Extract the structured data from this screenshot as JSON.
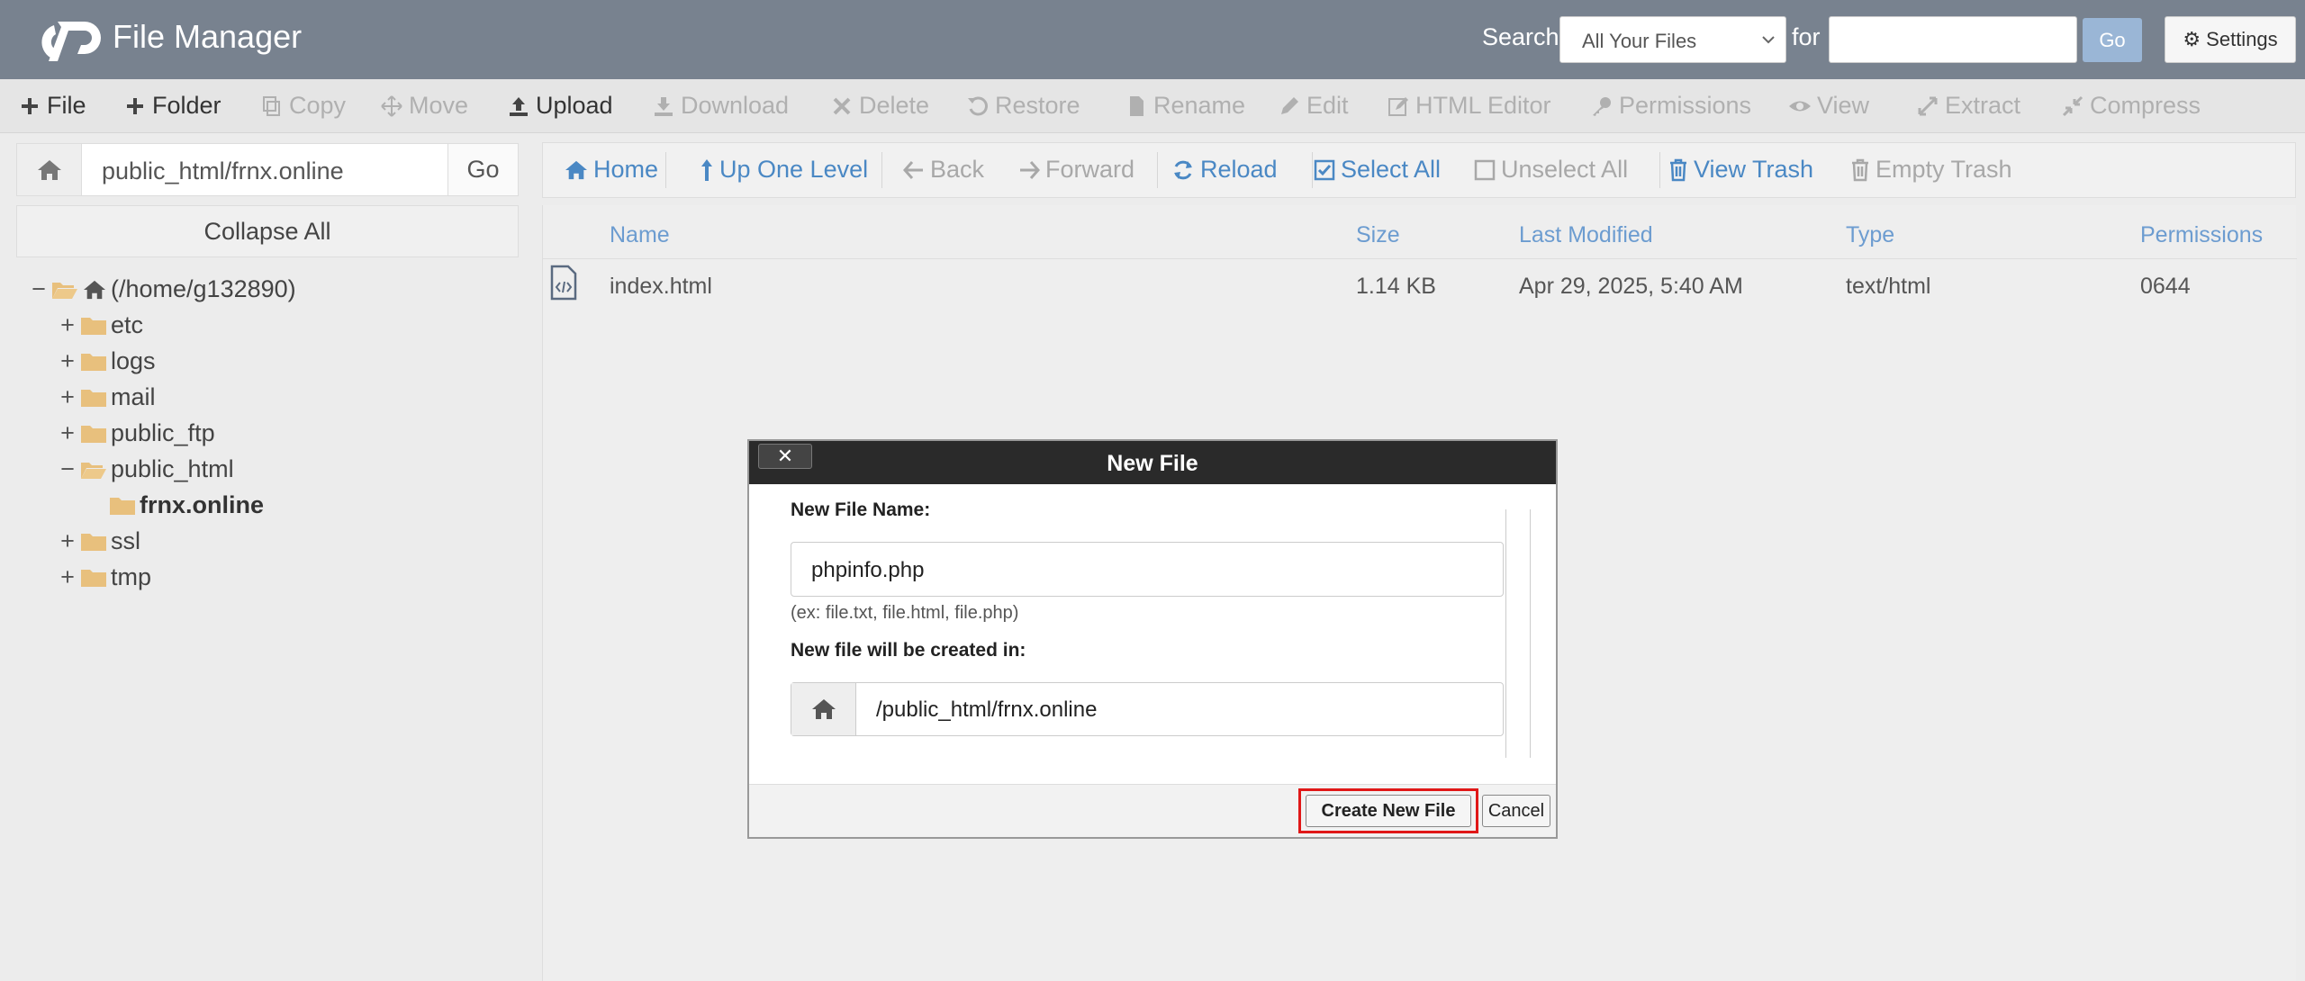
{
  "header": {
    "app_title": "File Manager",
    "search_label": "Search",
    "search_scope": "All Your Files",
    "for_label": "for",
    "search_value": "",
    "go_label": "Go",
    "settings_label": "Settings"
  },
  "toolbar": {
    "items": [
      {
        "label": "File",
        "icon": "plus-icon",
        "enabled": true
      },
      {
        "label": "Folder",
        "icon": "plus-icon",
        "enabled": true
      },
      {
        "label": "Copy",
        "icon": "copy-icon",
        "enabled": false
      },
      {
        "label": "Move",
        "icon": "move-icon",
        "enabled": false
      },
      {
        "label": "Upload",
        "icon": "upload-icon",
        "enabled": true
      },
      {
        "label": "Download",
        "icon": "download-icon",
        "enabled": false
      },
      {
        "label": "Delete",
        "icon": "delete-icon",
        "enabled": false
      },
      {
        "label": "Restore",
        "icon": "restore-icon",
        "enabled": false
      },
      {
        "label": "Rename",
        "icon": "rename-icon",
        "enabled": false
      },
      {
        "label": "Edit",
        "icon": "pencil-icon",
        "enabled": false
      },
      {
        "label": "HTML Editor",
        "icon": "html-editor-icon",
        "enabled": false
      },
      {
        "label": "Permissions",
        "icon": "key-icon",
        "enabled": false
      },
      {
        "label": "View",
        "icon": "eye-icon",
        "enabled": false
      },
      {
        "label": "Extract",
        "icon": "extract-icon",
        "enabled": false
      },
      {
        "label": "Compress",
        "icon": "compress-icon",
        "enabled": false
      }
    ]
  },
  "left_panel": {
    "path_value": "public_html/frnx.online",
    "go_label": "Go",
    "collapse_all_label": "Collapse All",
    "tree": [
      {
        "label": "(/home/g132890)",
        "toggle": "−",
        "open": true,
        "home": true
      },
      {
        "label": "etc",
        "toggle": "+"
      },
      {
        "label": "logs",
        "toggle": "+"
      },
      {
        "label": "mail",
        "toggle": "+"
      },
      {
        "label": "public_ftp",
        "toggle": "+"
      },
      {
        "label": "public_html",
        "toggle": "−",
        "open": true
      },
      {
        "label": "frnx.online",
        "toggle": "",
        "bold": true
      },
      {
        "label": "ssl",
        "toggle": "+"
      },
      {
        "label": "tmp",
        "toggle": "+"
      }
    ]
  },
  "nav_bar": {
    "items": [
      {
        "label": "Home",
        "enabled": true
      },
      {
        "label": "Up One Level",
        "enabled": true
      },
      {
        "label": "Back",
        "enabled": false
      },
      {
        "label": "Forward",
        "enabled": false
      },
      {
        "label": "Reload",
        "enabled": true
      },
      {
        "label": "Select All",
        "enabled": true
      },
      {
        "label": "Unselect All",
        "enabled": false
      },
      {
        "label": "View Trash",
        "enabled": true
      },
      {
        "label": "Empty Trash",
        "enabled": false
      }
    ]
  },
  "file_table": {
    "columns": [
      "Name",
      "Size",
      "Last Modified",
      "Type",
      "Permissions"
    ],
    "rows": [
      {
        "name": "index.html",
        "size": "1.14 KB",
        "modified": "Apr 29, 2025, 5:40 AM",
        "type": "text/html",
        "permissions": "0644"
      }
    ]
  },
  "modal": {
    "title": "New File",
    "close_label": "✕",
    "name_label": "New File Name:",
    "name_value": "phpinfo.php",
    "name_hint": "(ex: file.txt, file.html, file.php)",
    "dir_label": "New file will be created in:",
    "dir_value": "/public_html/frnx.online",
    "create_label": "Create New File",
    "cancel_label": "Cancel"
  },
  "colors": {
    "header_bg": "#78828f",
    "link_blue": "#4a88c4",
    "folder_tan": "#e8c07d",
    "highlight_red": "#e01818"
  }
}
